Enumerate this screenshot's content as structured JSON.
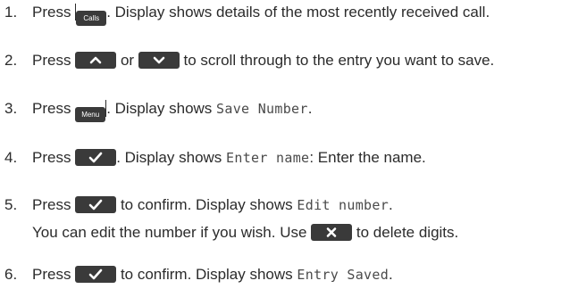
{
  "steps": [
    {
      "number": "1.",
      "press": "Press",
      "key": "Calls",
      "rest": ". Display shows details of the most recently received call."
    },
    {
      "number": "2.",
      "press": "Press",
      "or": "or",
      "rest": "to scroll through to the entry you want to save.",
      "icons": [
        "up-arrow-icon",
        "down-arrow-icon"
      ]
    },
    {
      "number": "3.",
      "press": "Press",
      "key": "Menu",
      "rest": ". Display shows",
      "display": "Save Number",
      "end": "."
    },
    {
      "number": "4.",
      "press": "Press",
      "rest": ". Display shows",
      "display": "Enter name",
      "end": ": Enter the name.",
      "icons": [
        "check-icon"
      ]
    },
    {
      "number": "5.",
      "press": "Press",
      "rest": "to confirm. Display shows",
      "display": "Edit number",
      "end": ".",
      "icons": [
        "check-icon"
      ],
      "continuation": {
        "before": "You can edit the number if you wish. Use",
        "after": "to delete digits.",
        "icons": [
          "delete-x-icon"
        ]
      }
    },
    {
      "number": "6.",
      "press": "Press",
      "rest": "to confirm. Display shows",
      "display": "Entry Saved",
      "end": ".",
      "icons": [
        "check-icon"
      ]
    }
  ],
  "colors": {
    "text": "#2b2b2b",
    "key_bg": "#3a3a3a",
    "key_fg": "#ffffff"
  }
}
